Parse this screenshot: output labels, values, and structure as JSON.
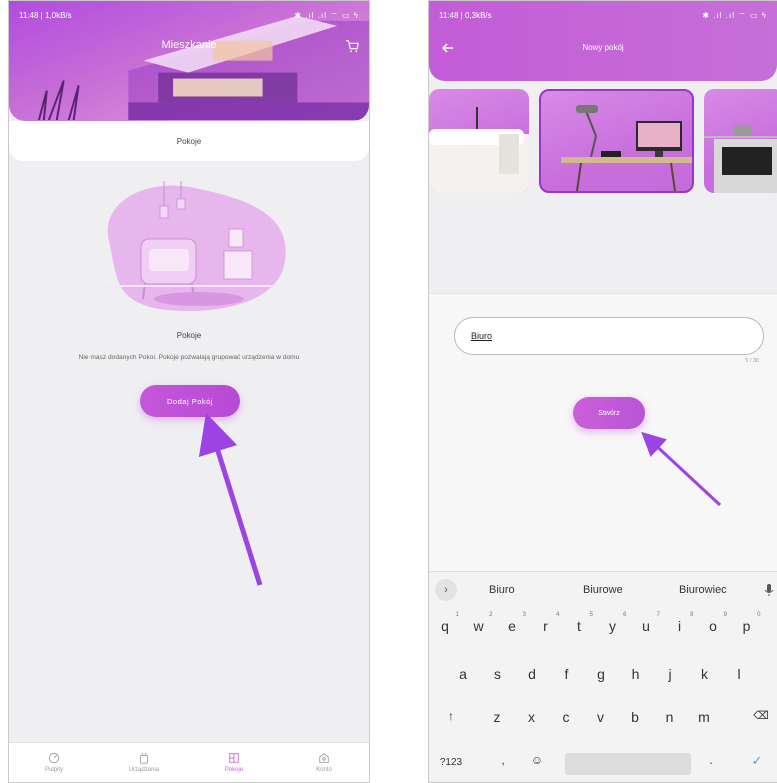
{
  "phone1": {
    "status": {
      "time": "11:48 | 1,0kB/s",
      "icons": "✱ .ıl .ıl ⌔ ▭ ϟ"
    },
    "header_title": "Mieszkanie",
    "tab_label": "Pokoje",
    "empty_title": "Pokoje",
    "empty_description": "Nie masz dodanych Pokoi. Pokoje pozwalają grupować urządzenia w domu",
    "add_button": "Dodaj Pokój",
    "nav": [
      {
        "label": "Pulpity",
        "icon": "dashboard-icon"
      },
      {
        "label": "Urządzenia",
        "icon": "device-icon"
      },
      {
        "label": "Pokoje",
        "icon": "rooms-icon",
        "active": true
      },
      {
        "label": "Konto",
        "icon": "account-icon"
      }
    ],
    "accent": "#c563d3"
  },
  "phone2": {
    "status": {
      "time": "11:48 | 0,3kB/s",
      "icons": "✱ .ıl .ıl ⌔ ▭ ϟ"
    },
    "header_title": "Nowy pokój",
    "room_name_value": "Biuro",
    "char_counter": "5 / 30",
    "create_button": "Stwórz",
    "suggestions": [
      "Biuro",
      "Biurowe",
      "Biurowiec"
    ],
    "keyboard": {
      "row1": [
        "q",
        "w",
        "e",
        "r",
        "t",
        "y",
        "u",
        "i",
        "o",
        "p"
      ],
      "row1_hints": [
        "1",
        "2",
        "3",
        "4",
        "5",
        "6",
        "7",
        "8",
        "9",
        "0"
      ],
      "row2": [
        "a",
        "s",
        "d",
        "f",
        "g",
        "h",
        "j",
        "k",
        "l"
      ],
      "row3": [
        "z",
        "x",
        "c",
        "v",
        "b",
        "n",
        "m"
      ],
      "symbols_key": "?123",
      "comma": ",",
      "period": "."
    },
    "accent": "#c35cd7"
  }
}
